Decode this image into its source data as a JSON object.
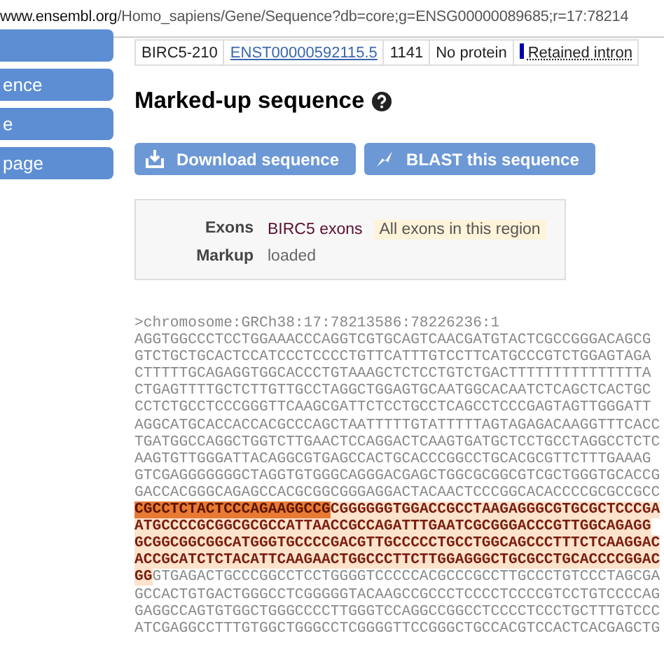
{
  "address_bar": {
    "url": "www.ensembl.org/Homo_sapiens/Gene/Sequence?db=core;g=ENSG00000089685;r=17:78214"
  },
  "sidebar": {
    "items": [
      {
        "label": "ence"
      },
      {
        "label": "e"
      },
      {
        "label": "page"
      }
    ]
  },
  "transcript_row": {
    "cells": [
      {
        "text": "BIRC5-210",
        "kind": "text"
      },
      {
        "text": "ENST00000592115.5",
        "kind": "link"
      },
      {
        "text": "1141",
        "kind": "text"
      },
      {
        "text": "No protein",
        "kind": "text"
      },
      {
        "text": "Retained intron",
        "kind": "biotype",
        "color": "#0000aa"
      }
    ]
  },
  "section": {
    "title": "Marked-up sequence"
  },
  "buttons": [
    {
      "label": "Download sequence"
    },
    {
      "label": "BLAST this sequence"
    }
  ],
  "markup_key": {
    "rows": [
      {
        "label": "Exons",
        "items": [
          {
            "text": "BIRC5 exons",
            "kind": "exon"
          },
          {
            "text": "All exons in this region",
            "kind": "region"
          }
        ]
      },
      {
        "label": "Markup",
        "items": [
          {
            "text": "loaded",
            "kind": "plain"
          }
        ]
      }
    ]
  },
  "sequence": {
    "header": ">chromosome:GRCh38:17:78213586:78226236:1",
    "lines": [
      {
        "segments": [
          {
            "text": "AGGTGGCCCTCCTGGAAACCCAGGTCGTGCAGTCAACGATGTACTCGCCGGGACAGCG",
            "kind": "flank"
          }
        ]
      },
      {
        "segments": [
          {
            "text": "GTCTGCTGCACTCCATCCCTCCCCTGTTCATTTGTCCTTCATGCCCGTCTGGAGTAGA",
            "kind": "flank"
          }
        ]
      },
      {
        "segments": [
          {
            "text": "CTTTTTGCAGAGGTGGCACCCTGTAAAGCTCTCCTGTCTGACTTTTTTTTTTTTTTTA",
            "kind": "flank"
          }
        ]
      },
      {
        "segments": [
          {
            "text": "CTGAGTTTTGCTCTTGTTGCCTAGGCTGGAGTGCAATGGCACAATCTCAGCTCACTGC",
            "kind": "flank"
          }
        ]
      },
      {
        "segments": [
          {
            "text": "CCTCTGCCTCCCGGGTTCAAGCGATTCTCCTGCCTCAGCCTCCCGAGTAGTTGGGATT",
            "kind": "flank"
          }
        ]
      },
      {
        "segments": [
          {
            "text": "AGGCATGCACCACCACGCCCAGCTAATTTTTGTATTTTTAGTAGAGACAAGGTTTCACC",
            "kind": "flank"
          }
        ]
      },
      {
        "segments": [
          {
            "text": "TGATGGCCAGGCTGGTCTTGAACTCCAGGACTCAAGTGATGCTCCTGCCTAGGCCTCTC",
            "kind": "flank"
          }
        ]
      },
      {
        "segments": [
          {
            "text": "AAGTGTTGGGATTACAGGCGTGAGCCACTGCACCCGGCCTGCACGCGTTCTTTGAAAG",
            "kind": "flank"
          }
        ]
      },
      {
        "segments": [
          {
            "text": "GTCGAGGGGGGGCTAGGTGTGGGCAGGGACGAGCTGGCGCGGCGTCGCTGGGTGCACCG",
            "kind": "flank"
          }
        ]
      },
      {
        "segments": [
          {
            "text": "GACCACGGGCAGAGCCACGCGGCGGGAGGACTACAACTCCCGGCACACCCCGCGCCGCC",
            "kind": "flank"
          }
        ]
      },
      {
        "segments": [
          {
            "text": "CGCCTCTACTCCCAGAAGGCCG",
            "kind": "highlight"
          },
          {
            "text": "CGGGGGGTGGACCGCCTAAGAGGGCGTGCGCTCCCGA",
            "kind": "exon"
          }
        ]
      },
      {
        "segments": [
          {
            "text": "ATGCCCCGCGGCGCGCCATTAACCGCCAGATTTGAATCGCGGGACCCGTTGGCAGAGG",
            "kind": "exon"
          }
        ]
      },
      {
        "segments": [
          {
            "text": "GCGGCGGCGGCATGGGTGCCCCGACGTTGCCCCCTGCCTGGCAGCCCTTTCTCAAGGAC",
            "kind": "exon"
          }
        ]
      },
      {
        "segments": [
          {
            "text": "ACCGCATCTCTACATTCAAGAACTGGCCCTTCTTGGAGGGCTGCGCCTGCACCCCGGAC",
            "kind": "exon"
          }
        ]
      },
      {
        "segments": [
          {
            "text": "GG",
            "kind": "exon"
          },
          {
            "text": "GTGAGACTGCCCGGCCTCCTGGGGTCCCCCACGCCCGCCTTGCCCTGTCCCTAGCGA",
            "kind": "flank"
          }
        ]
      },
      {
        "segments": [
          {
            "text": "GCCACTGTGACTGGGCCTCGGGGGTACAAGCCGCCCTCCCCTCCCCGTCCTGTCCCCAG",
            "kind": "flank"
          }
        ]
      },
      {
        "segments": [
          {
            "text": "GAGGCCAGTGTGGCTGGGCCCCTTGGGTCCAGGCCGGCCTCCCCTCCCTGCTTTGTCCC",
            "kind": "flank"
          }
        ]
      },
      {
        "segments": [
          {
            "text": "ATCGAGGCCTTTGTGGCTGGGCCTCGGGGTTCCGGGCTGCCACGTCCACTCACGAGCTG",
            "kind": "flank"
          }
        ]
      }
    ]
  }
}
